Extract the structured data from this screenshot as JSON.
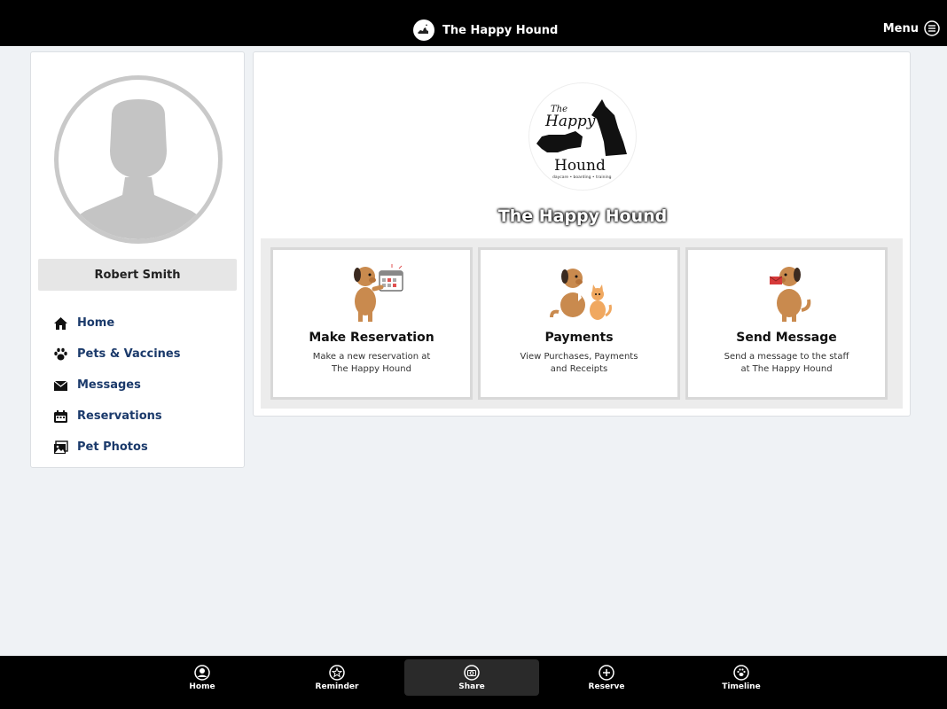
{
  "header": {
    "title": "The Happy Hound",
    "menu_label": "Menu"
  },
  "sidebar": {
    "user_name": "Robert Smith",
    "items": [
      {
        "label": "Home",
        "icon": "home-icon"
      },
      {
        "label": "Pets & Vaccines",
        "icon": "paw-icon"
      },
      {
        "label": "Messages",
        "icon": "envelope-icon"
      },
      {
        "label": "Reservations",
        "icon": "calendar-icon"
      },
      {
        "label": "Pet Photos",
        "icon": "photos-icon"
      }
    ]
  },
  "main": {
    "hero_title": "The Happy Hound",
    "logo_text": {
      "the": "The",
      "happy": "Happy",
      "hound": "Hound",
      "tagline": "daycare • boarding • training"
    },
    "tiles": [
      {
        "title": "Make Reservation",
        "desc_line1": "Make a new reservation at",
        "desc_line2": "The Happy Hound"
      },
      {
        "title": "Payments",
        "desc_line1": "View Purchases, Payments",
        "desc_line2": "and Receipts"
      },
      {
        "title": "Send Message",
        "desc_line1": "Send a message to the staff",
        "desc_line2": "at The Happy Hound"
      }
    ]
  },
  "bottom_nav": {
    "items": [
      {
        "label": "Home",
        "icon": "user-circle-icon"
      },
      {
        "label": "Reminder",
        "icon": "star-icon"
      },
      {
        "label": "Share",
        "icon": "camera-icon",
        "active": true
      },
      {
        "label": "Reserve",
        "icon": "plus-circle-icon"
      },
      {
        "label": "Timeline",
        "icon": "paw-circle-icon"
      }
    ]
  },
  "colors": {
    "nav_text": "#1b3a6b",
    "bar_bg": "#000000",
    "page_bg": "#eff2f5",
    "dog_brown": "#c98a4e"
  }
}
